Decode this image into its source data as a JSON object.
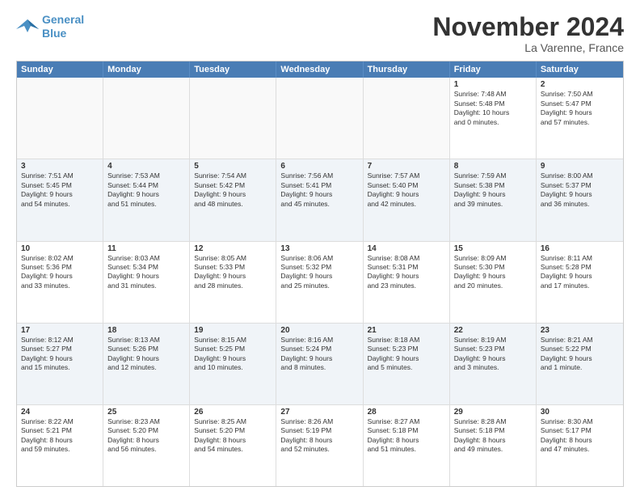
{
  "logo": {
    "line1": "General",
    "line2": "Blue"
  },
  "title": "November 2024",
  "location": "La Varenne, France",
  "days_of_week": [
    "Sunday",
    "Monday",
    "Tuesday",
    "Wednesday",
    "Thursday",
    "Friday",
    "Saturday"
  ],
  "rows": [
    {
      "alt": false,
      "cells": [
        {
          "day": "",
          "detail": ""
        },
        {
          "day": "",
          "detail": ""
        },
        {
          "day": "",
          "detail": ""
        },
        {
          "day": "",
          "detail": ""
        },
        {
          "day": "",
          "detail": ""
        },
        {
          "day": "1",
          "detail": "Sunrise: 7:48 AM\nSunset: 5:48 PM\nDaylight: 10 hours\nand 0 minutes."
        },
        {
          "day": "2",
          "detail": "Sunrise: 7:50 AM\nSunset: 5:47 PM\nDaylight: 9 hours\nand 57 minutes."
        }
      ]
    },
    {
      "alt": true,
      "cells": [
        {
          "day": "3",
          "detail": "Sunrise: 7:51 AM\nSunset: 5:45 PM\nDaylight: 9 hours\nand 54 minutes."
        },
        {
          "day": "4",
          "detail": "Sunrise: 7:53 AM\nSunset: 5:44 PM\nDaylight: 9 hours\nand 51 minutes."
        },
        {
          "day": "5",
          "detail": "Sunrise: 7:54 AM\nSunset: 5:42 PM\nDaylight: 9 hours\nand 48 minutes."
        },
        {
          "day": "6",
          "detail": "Sunrise: 7:56 AM\nSunset: 5:41 PM\nDaylight: 9 hours\nand 45 minutes."
        },
        {
          "day": "7",
          "detail": "Sunrise: 7:57 AM\nSunset: 5:40 PM\nDaylight: 9 hours\nand 42 minutes."
        },
        {
          "day": "8",
          "detail": "Sunrise: 7:59 AM\nSunset: 5:38 PM\nDaylight: 9 hours\nand 39 minutes."
        },
        {
          "day": "9",
          "detail": "Sunrise: 8:00 AM\nSunset: 5:37 PM\nDaylight: 9 hours\nand 36 minutes."
        }
      ]
    },
    {
      "alt": false,
      "cells": [
        {
          "day": "10",
          "detail": "Sunrise: 8:02 AM\nSunset: 5:36 PM\nDaylight: 9 hours\nand 33 minutes."
        },
        {
          "day": "11",
          "detail": "Sunrise: 8:03 AM\nSunset: 5:34 PM\nDaylight: 9 hours\nand 31 minutes."
        },
        {
          "day": "12",
          "detail": "Sunrise: 8:05 AM\nSunset: 5:33 PM\nDaylight: 9 hours\nand 28 minutes."
        },
        {
          "day": "13",
          "detail": "Sunrise: 8:06 AM\nSunset: 5:32 PM\nDaylight: 9 hours\nand 25 minutes."
        },
        {
          "day": "14",
          "detail": "Sunrise: 8:08 AM\nSunset: 5:31 PM\nDaylight: 9 hours\nand 23 minutes."
        },
        {
          "day": "15",
          "detail": "Sunrise: 8:09 AM\nSunset: 5:30 PM\nDaylight: 9 hours\nand 20 minutes."
        },
        {
          "day": "16",
          "detail": "Sunrise: 8:11 AM\nSunset: 5:28 PM\nDaylight: 9 hours\nand 17 minutes."
        }
      ]
    },
    {
      "alt": true,
      "cells": [
        {
          "day": "17",
          "detail": "Sunrise: 8:12 AM\nSunset: 5:27 PM\nDaylight: 9 hours\nand 15 minutes."
        },
        {
          "day": "18",
          "detail": "Sunrise: 8:13 AM\nSunset: 5:26 PM\nDaylight: 9 hours\nand 12 minutes."
        },
        {
          "day": "19",
          "detail": "Sunrise: 8:15 AM\nSunset: 5:25 PM\nDaylight: 9 hours\nand 10 minutes."
        },
        {
          "day": "20",
          "detail": "Sunrise: 8:16 AM\nSunset: 5:24 PM\nDaylight: 9 hours\nand 8 minutes."
        },
        {
          "day": "21",
          "detail": "Sunrise: 8:18 AM\nSunset: 5:23 PM\nDaylight: 9 hours\nand 5 minutes."
        },
        {
          "day": "22",
          "detail": "Sunrise: 8:19 AM\nSunset: 5:23 PM\nDaylight: 9 hours\nand 3 minutes."
        },
        {
          "day": "23",
          "detail": "Sunrise: 8:21 AM\nSunset: 5:22 PM\nDaylight: 9 hours\nand 1 minute."
        }
      ]
    },
    {
      "alt": false,
      "cells": [
        {
          "day": "24",
          "detail": "Sunrise: 8:22 AM\nSunset: 5:21 PM\nDaylight: 8 hours\nand 59 minutes."
        },
        {
          "day": "25",
          "detail": "Sunrise: 8:23 AM\nSunset: 5:20 PM\nDaylight: 8 hours\nand 56 minutes."
        },
        {
          "day": "26",
          "detail": "Sunrise: 8:25 AM\nSunset: 5:20 PM\nDaylight: 8 hours\nand 54 minutes."
        },
        {
          "day": "27",
          "detail": "Sunrise: 8:26 AM\nSunset: 5:19 PM\nDaylight: 8 hours\nand 52 minutes."
        },
        {
          "day": "28",
          "detail": "Sunrise: 8:27 AM\nSunset: 5:18 PM\nDaylight: 8 hours\nand 51 minutes."
        },
        {
          "day": "29",
          "detail": "Sunrise: 8:28 AM\nSunset: 5:18 PM\nDaylight: 8 hours\nand 49 minutes."
        },
        {
          "day": "30",
          "detail": "Sunrise: 8:30 AM\nSunset: 5:17 PM\nDaylight: 8 hours\nand 47 minutes."
        }
      ]
    }
  ]
}
